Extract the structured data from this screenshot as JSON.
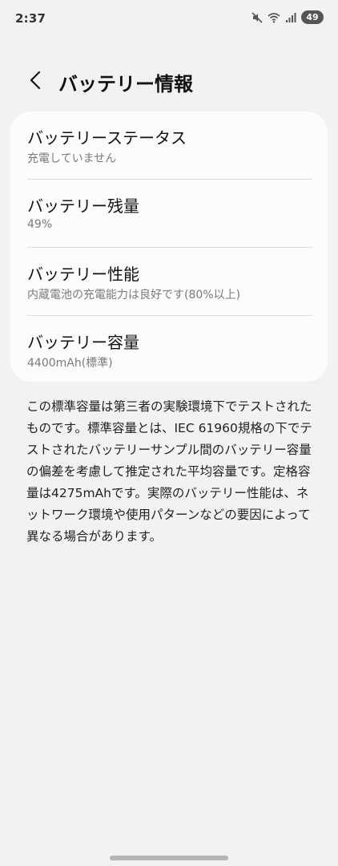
{
  "status_bar": {
    "time": "2:37",
    "battery_level": "49",
    "icons": [
      "mute-icon",
      "wifi-icon",
      "signal-icon",
      "battery-icon"
    ]
  },
  "header": {
    "back_icon": "chevron-left-icon",
    "title": "バッテリー情報"
  },
  "rows": [
    {
      "title": "バッテリーステータス",
      "value": "充電していません"
    },
    {
      "title": "バッテリー残量",
      "value": "49%"
    },
    {
      "title": "バッテリー性能",
      "value": "内蔵電池の充電能力は良好です(80%以上)"
    },
    {
      "title": "バッテリー容量",
      "value": "4400mAh(標準)"
    }
  ],
  "description": "この標準容量は第三者の実験環境下でテストされたものです。標準容量とは、IEC 61960規格の下でテストされたバッテリーサンプル間のバッテリー容量の偏差を考慮して推定された平均容量です。定格容量は4275mAhです。実際のバッテリー性能は、ネットワーク環境や使用パターンなどの要因によって異なる場合があります。",
  "colors": {
    "background": "#f2f2f4",
    "card": "#fcfcfe",
    "secondary_text": "#7a7a7a"
  }
}
